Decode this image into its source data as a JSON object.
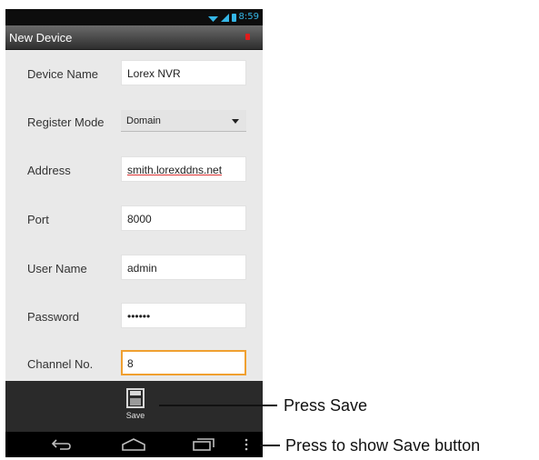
{
  "status_bar": {
    "time": "8:59"
  },
  "title_bar": {
    "title": "New Device"
  },
  "form": {
    "device_name": {
      "label": "Device Name",
      "value": "Lorex NVR"
    },
    "register_mode": {
      "label": "Register Mode",
      "value": "Domain"
    },
    "address": {
      "label": "Address",
      "value": "smith.lorexddns.net"
    },
    "port": {
      "label": "Port",
      "value": "8000"
    },
    "user_name": {
      "label": "User Name",
      "value": "admin"
    },
    "password": {
      "label": "Password",
      "value": "••••••"
    },
    "channel_no": {
      "label": "Channel No.",
      "value": "8"
    }
  },
  "action_bar": {
    "save_label": "Save"
  },
  "annotations": {
    "press_save": "Press Save",
    "press_menu": "Press to show Save button"
  },
  "colors": {
    "accent_blue": "#35b6e6",
    "focus_orange": "#f0a030",
    "alert_red": "#e01b1b"
  }
}
